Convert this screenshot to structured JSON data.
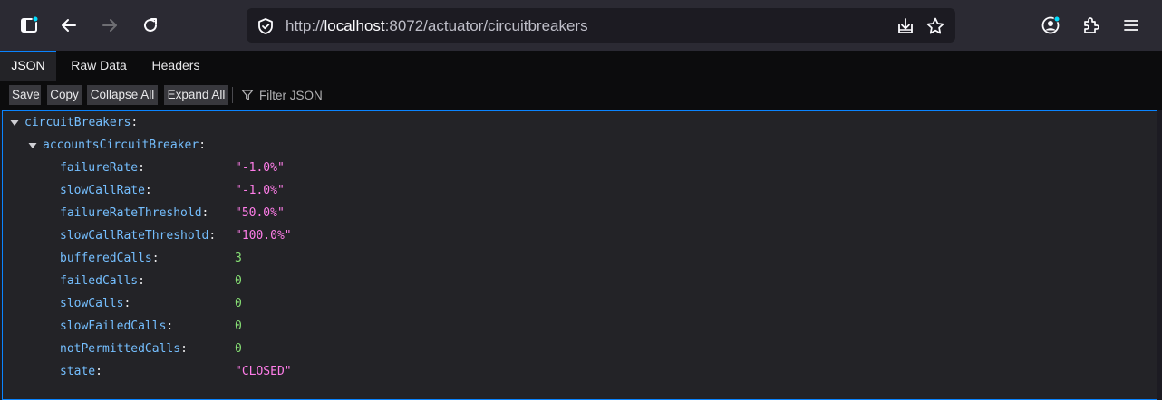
{
  "browser": {
    "url_protocol": "http://",
    "url_host": "localhost",
    "url_path": ":8072/actuator/circuitbreakers"
  },
  "viewer": {
    "tabs": [
      {
        "label": "JSON",
        "selected": true
      },
      {
        "label": "Raw Data",
        "selected": false
      },
      {
        "label": "Headers",
        "selected": false
      }
    ],
    "toolbar": {
      "save": "Save",
      "copy": "Copy",
      "collapse_all": "Collapse All",
      "expand_all": "Expand All",
      "filter_placeholder": "Filter JSON"
    }
  },
  "json": {
    "root_key": "circuitBreakers",
    "breaker_key": "accountsCircuitBreaker",
    "colon": ":",
    "fields": [
      {
        "key": "failureRate",
        "value": "\"-1.0%\"",
        "type": "string"
      },
      {
        "key": "slowCallRate",
        "value": "\"-1.0%\"",
        "type": "string"
      },
      {
        "key": "failureRateThreshold",
        "value": "\"50.0%\"",
        "type": "string"
      },
      {
        "key": "slowCallRateThreshold",
        "value": "\"100.0%\"",
        "type": "string"
      },
      {
        "key": "bufferedCalls",
        "value": "3",
        "type": "number"
      },
      {
        "key": "failedCalls",
        "value": "0",
        "type": "number"
      },
      {
        "key": "slowCalls",
        "value": "0",
        "type": "number"
      },
      {
        "key": "slowFailedCalls",
        "value": "0",
        "type": "number"
      },
      {
        "key": "notPermittedCalls",
        "value": "0",
        "type": "number"
      },
      {
        "key": "state",
        "value": "\"CLOSED\"",
        "type": "string"
      }
    ]
  }
}
